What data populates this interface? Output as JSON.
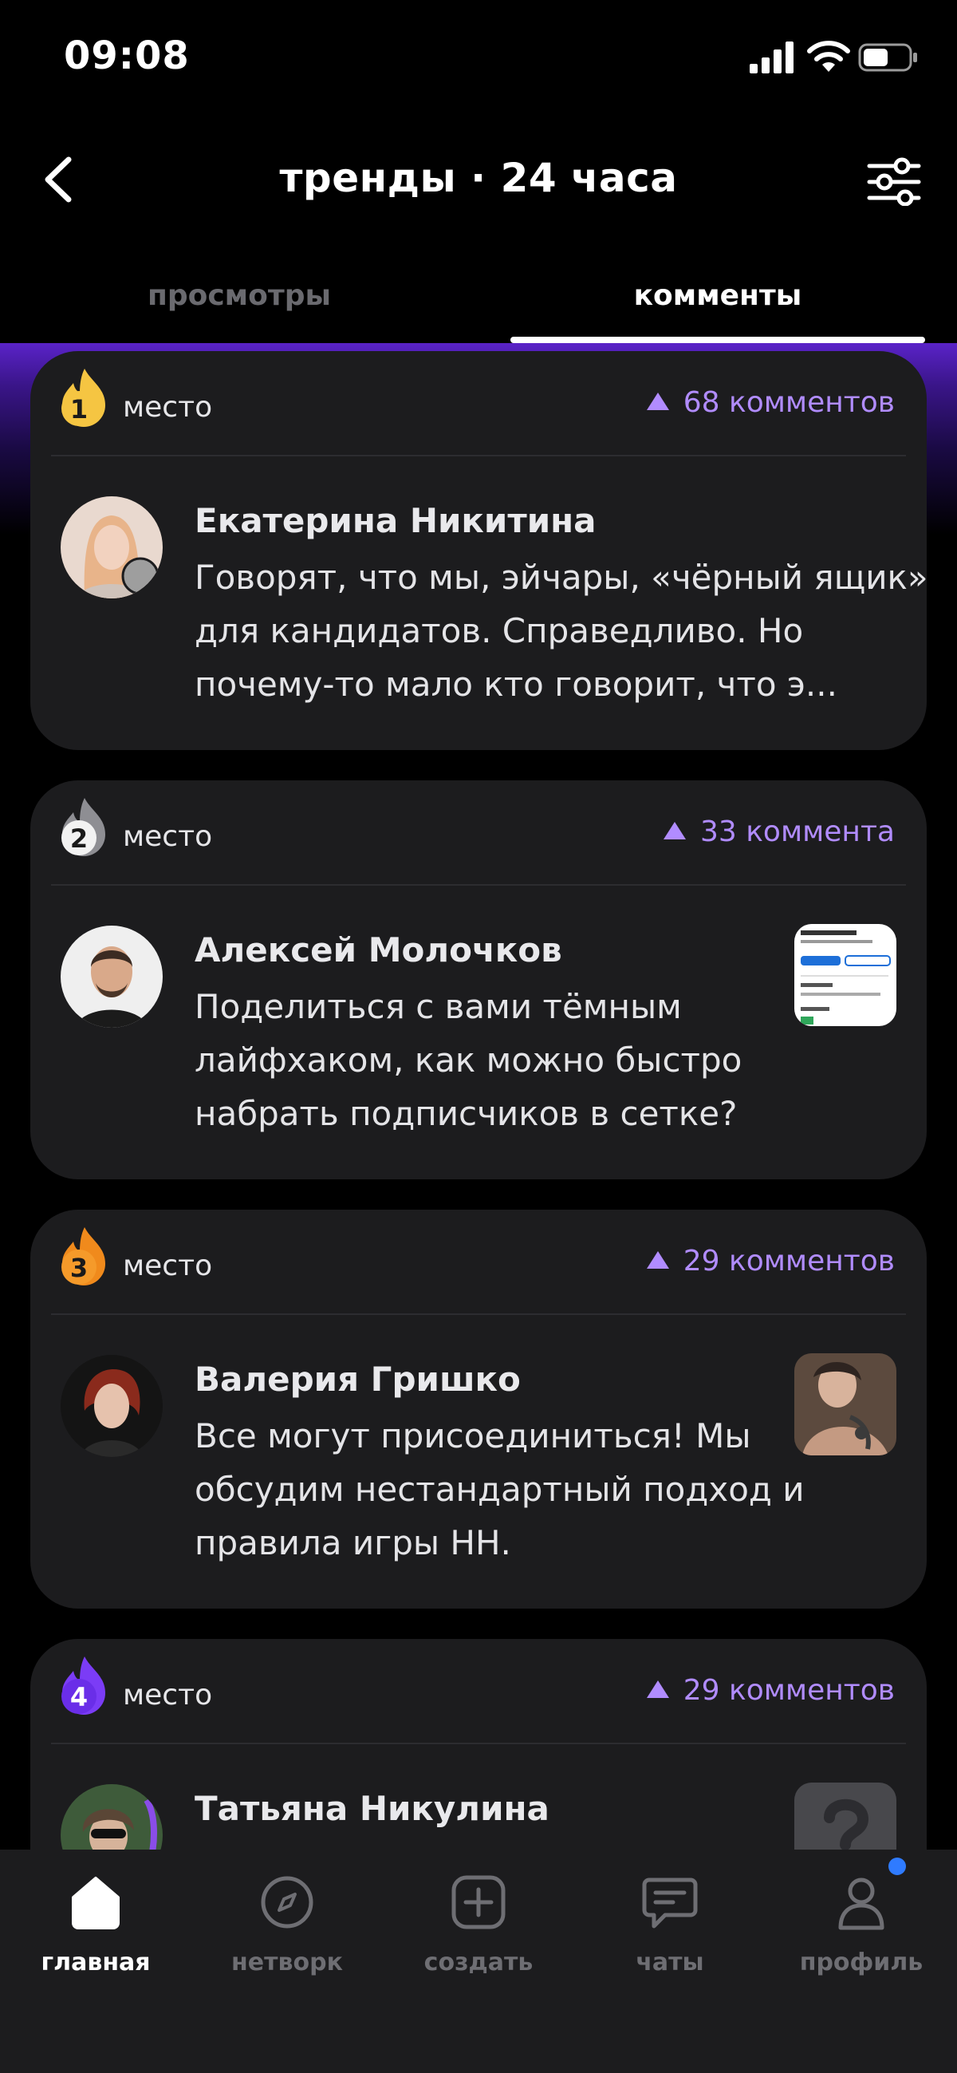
{
  "status_bar": {
    "time": "09:08"
  },
  "header": {
    "title": "тренды · 24 часа",
    "back_icon": "chevron-left-icon",
    "filter_icon": "sliders-icon"
  },
  "tabs": [
    {
      "label": "просмотры",
      "active": false
    },
    {
      "label": "комменты",
      "active": true
    }
  ],
  "colors": {
    "accent": "#b18cff",
    "card": "#1c1c1e",
    "gold": "#f5c542",
    "silver": "#9a9a9a",
    "bronze": "#f08a1c",
    "purple": "#7b3cf6"
  },
  "feed": [
    {
      "rank": "1",
      "place_label": "место",
      "count": "68 комментов",
      "author": "Екатерина Никитина",
      "text": "Говорят, что мы, эйчары, «чёрный ящик» для кандидатов. Справедливо. Но почему-то мало кто говорит, что э...",
      "has_thumb": false
    },
    {
      "rank": "2",
      "place_label": "место",
      "count": "33 коммента",
      "author": "Алексей Молочков",
      "text": "Поделиться с вами тёмным лайфхаком, как можно быстро набрать подписчиков в сетке?",
      "has_thumb": true
    },
    {
      "rank": "3",
      "place_label": "место",
      "count": "29 комментов",
      "author": "Валерия Гришко",
      "text": "Все могут присоединиться! Мы обсудим нестандартный подход и правила игры НН.",
      "has_thumb": true
    },
    {
      "rank": "4",
      "place_label": "место",
      "count": "29 комментов",
      "author": "Татьяна Никулина",
      "text": "",
      "has_thumb": true
    }
  ],
  "bottom_nav": [
    {
      "label": "главная",
      "icon": "home-icon",
      "active": true
    },
    {
      "label": "нетворк",
      "icon": "compass-icon",
      "active": false
    },
    {
      "label": "создать",
      "icon": "plus-square-icon",
      "active": false
    },
    {
      "label": "чаты",
      "icon": "chat-icon",
      "active": false
    },
    {
      "label": "профиль",
      "icon": "user-icon",
      "active": false
    }
  ]
}
